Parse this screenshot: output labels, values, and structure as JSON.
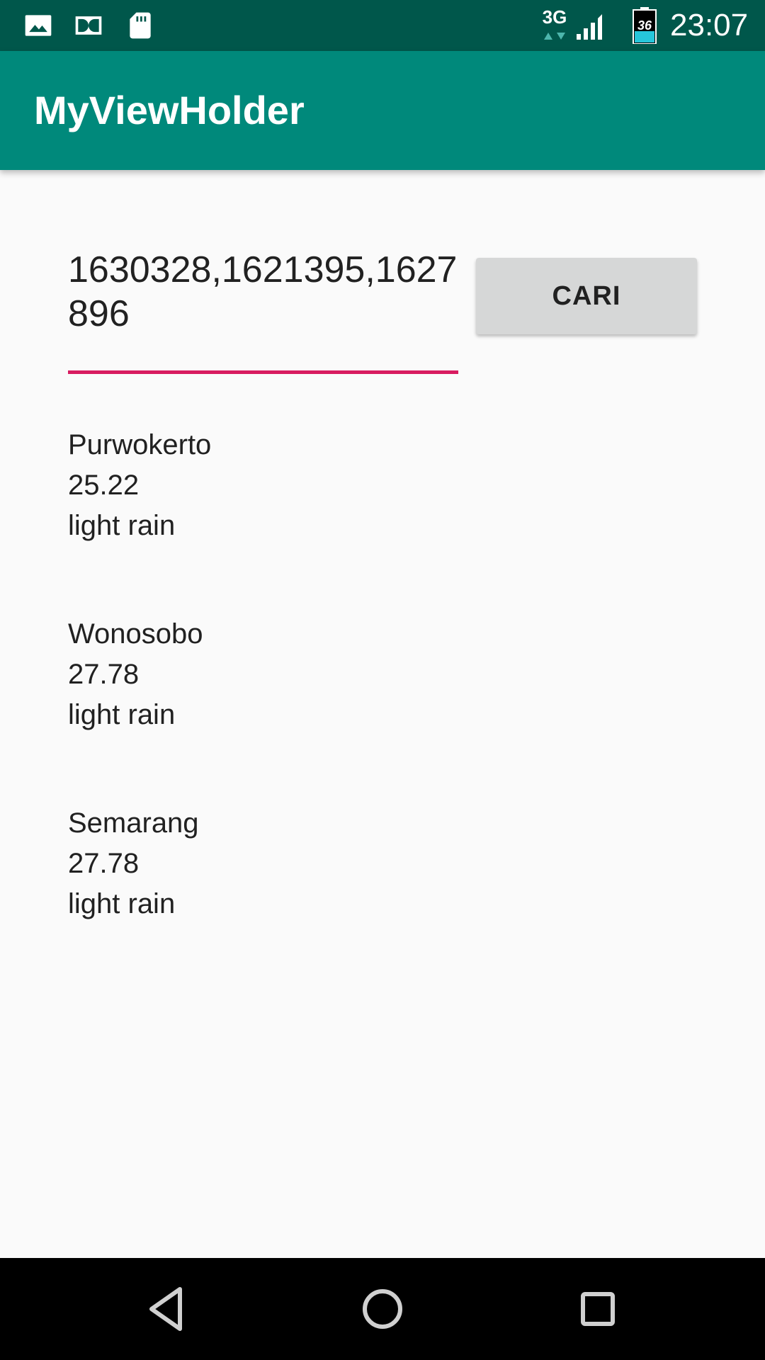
{
  "status_bar": {
    "network_type": "3G",
    "battery_level": "36",
    "time": "23:07",
    "icons": [
      "image-icon",
      "dolby-icon",
      "sd-card-icon",
      "signal-icon",
      "battery-icon"
    ]
  },
  "app_bar": {
    "title": "MyViewHolder"
  },
  "search": {
    "value": "1630328,1621395,1627896",
    "button_label": "CARI"
  },
  "results": [
    {
      "city": "Purwokerto",
      "temp": "25.22",
      "description": "light rain"
    },
    {
      "city": "Wonosobo",
      "temp": "27.78",
      "description": "light rain"
    },
    {
      "city": "Semarang",
      "temp": "27.78",
      "description": "light rain"
    }
  ],
  "colors": {
    "status_bar": "#00574b",
    "primary": "#00897b",
    "accent": "#d81b60",
    "background": "#fafafa",
    "button": "#d6d7d7"
  },
  "navigation": {
    "icons": [
      "back-icon",
      "home-icon",
      "recents-icon"
    ]
  }
}
